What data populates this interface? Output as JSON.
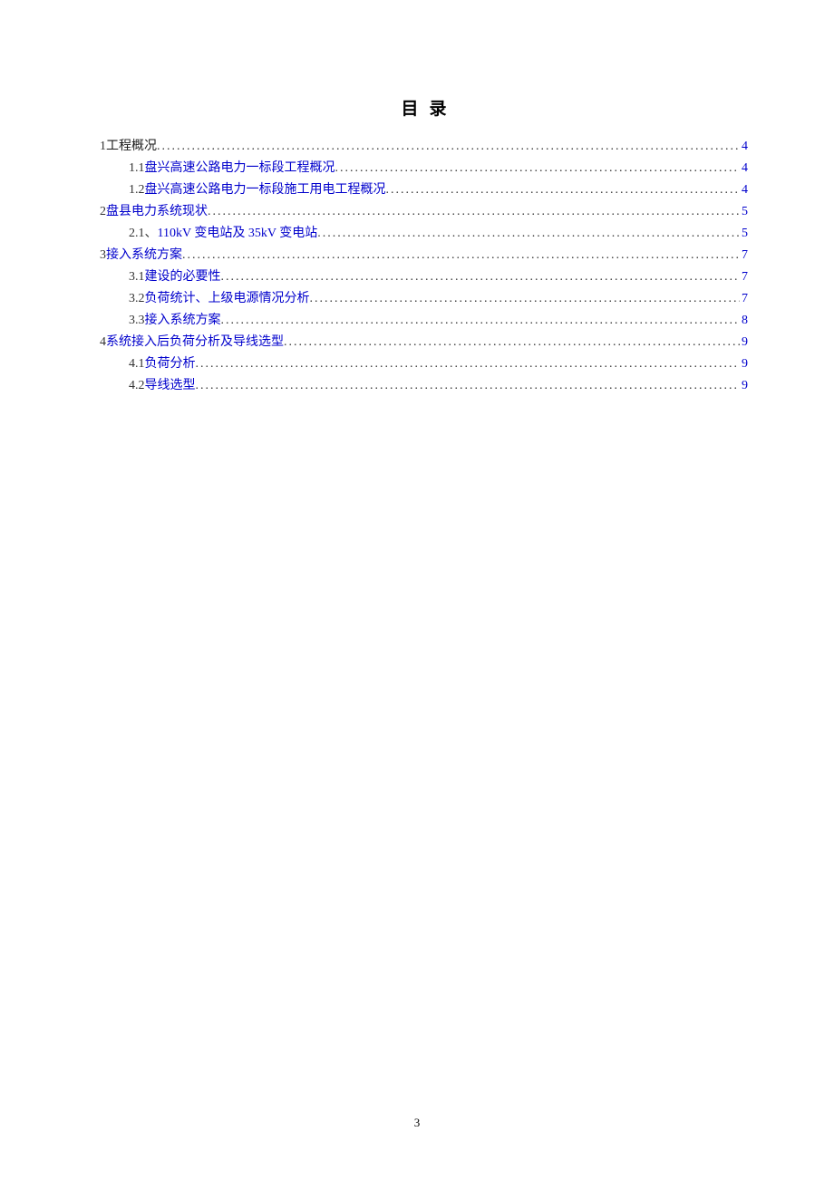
{
  "title": "目录",
  "page_number": "3",
  "toc": [
    {
      "level": 1,
      "num": "1 ",
      "text": "工程概况",
      "page": "4",
      "black": true
    },
    {
      "level": 2,
      "num": "1.1 ",
      "text": "盘兴高速公路电力一标段工程概况",
      "page": "4",
      "black": false
    },
    {
      "level": 2,
      "num": "1.2 ",
      "text": "盘兴高速公路电力一标段施工用电工程概况",
      "page": "4",
      "black": false
    },
    {
      "level": 1,
      "num": "2 ",
      "text": "盘县电力系统现状",
      "page": "5",
      "black": false
    },
    {
      "level": 2,
      "num": "2.1、",
      "text": "110kV 变电站及 35kV 变电站",
      "page": "5",
      "black": false
    },
    {
      "level": 1,
      "num": "3  ",
      "text": "接入系统方案",
      "page": "7",
      "black": false
    },
    {
      "level": 2,
      "num": "3.1 ",
      "text": "建设的必要性",
      "page": "7",
      "black": false
    },
    {
      "level": 2,
      "num": "3.2 ",
      "text": "负荷统计、上级电源情况分析",
      "page": "7",
      "black": false
    },
    {
      "level": 2,
      "num": "3.3 ",
      "text": "接入系统方案",
      "page": "8",
      "black": false
    },
    {
      "level": 1,
      "num": "4  ",
      "text": "系统接入后负荷分析及导线选型",
      "page": "9",
      "black": false
    },
    {
      "level": 2,
      "num": "4.1 ",
      "text": "负荷分析",
      "page": "9",
      "black": false
    },
    {
      "level": 2,
      "num": "4.2 ",
      "text": "导线选型",
      "page": "9",
      "black": false
    }
  ]
}
